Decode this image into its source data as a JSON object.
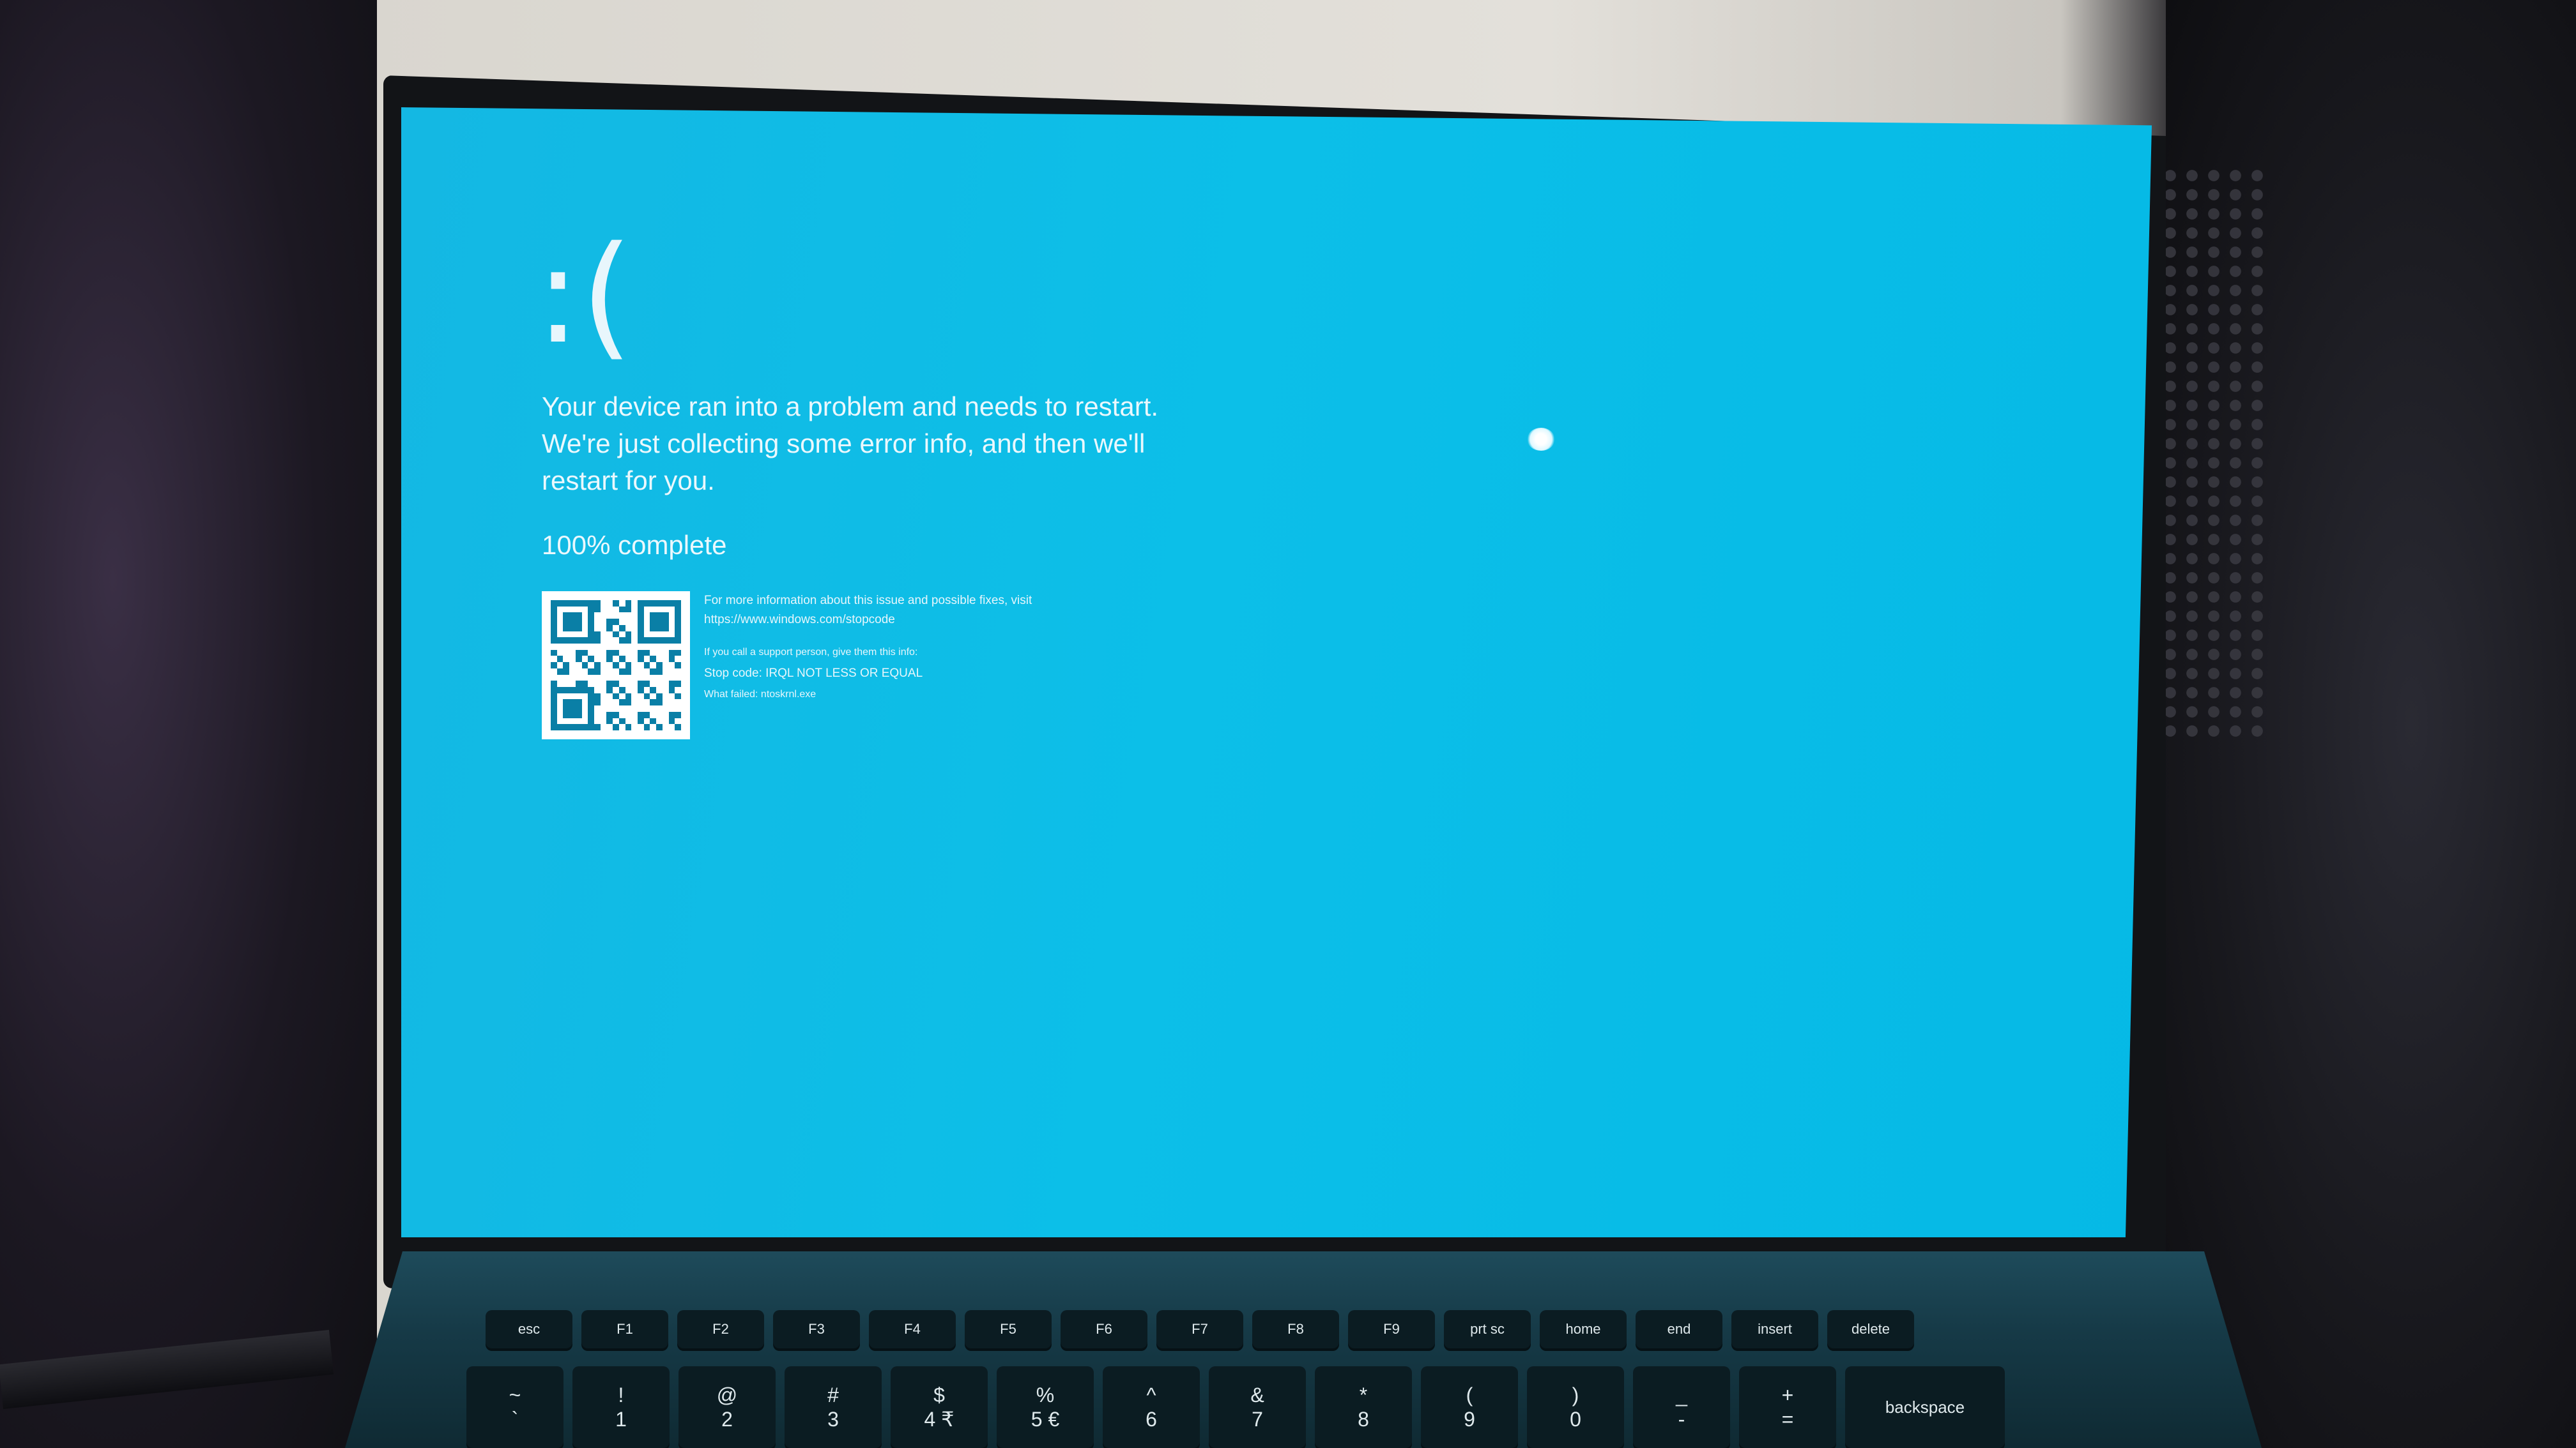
{
  "bsod": {
    "frown": ":(",
    "message": "Your device ran into a problem and needs to restart. We're just collecting some error info, and then we'll restart for you.",
    "progress": "100% complete",
    "more_info": "For more information about this issue and possible fixes, visit",
    "url": "https://www.windows.com/stopcode",
    "support_hint": "If you call a support person, give them this info:",
    "stop_code": "Stop code: IRQL NOT LESS OR EQUAL",
    "what_failed": "What failed: ntoskrnl.exe"
  },
  "keyboard": {
    "function_row": [
      "esc",
      "F1",
      "F2",
      "F3",
      "F4",
      "F5",
      "F6",
      "F7",
      "F8",
      "F9",
      "prt sc",
      "home",
      "end",
      "insert",
      "delete"
    ],
    "number_row": [
      {
        "top": "~",
        "bottom": "`"
      },
      {
        "top": "!",
        "bottom": "1"
      },
      {
        "top": "@",
        "bottom": "2"
      },
      {
        "top": "#",
        "bottom": "3"
      },
      {
        "top": "$",
        "bottom": "4 ₹"
      },
      {
        "top": "%",
        "bottom": "5 €"
      },
      {
        "top": "^",
        "bottom": "6"
      },
      {
        "top": "&",
        "bottom": "7"
      },
      {
        "top": "*",
        "bottom": "8"
      },
      {
        "top": "(",
        "bottom": "9"
      },
      {
        "top": ")",
        "bottom": "0"
      },
      {
        "top": "_",
        "bottom": "-"
      },
      {
        "top": "+",
        "bottom": "="
      }
    ],
    "backspace": "backspace"
  },
  "colors": {
    "screen_blue": "#0cbfe8",
    "text": "#eaf8fd"
  }
}
